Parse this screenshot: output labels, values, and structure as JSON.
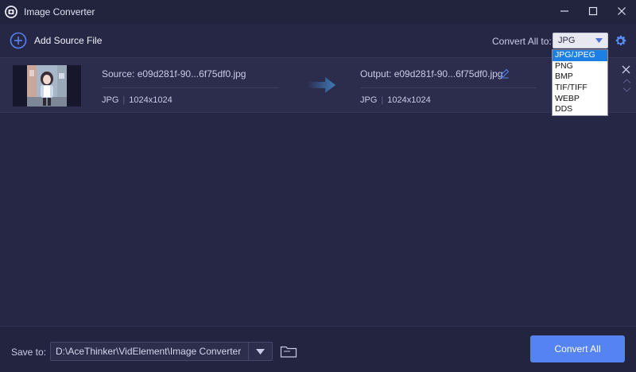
{
  "window": {
    "title": "Image Converter",
    "icons": {
      "logo": "converter-logo-icon",
      "minimize": "minimize-icon",
      "maximize": "maximize-icon",
      "close": "close-icon"
    }
  },
  "toolbar": {
    "add_source_label": "Add Source File",
    "add_icon": "plus-circle-icon",
    "convert_all_label": "Convert All to:",
    "format_value": "JPG",
    "settings_icon": "gear-icon"
  },
  "format_dropdown": {
    "options": [
      "JPG/JPEG",
      "PNG",
      "BMP",
      "TIF/TIFF",
      "WEBP",
      "DDS"
    ],
    "selected": "JPG/JPEG"
  },
  "file": {
    "source_label": "Source: e09d281f-90...6f75df0.jpg",
    "source_format": "JPG",
    "source_size": "1024x1024",
    "output_label": "Output: e09d281f-90...6f75df0.jpg",
    "output_format": "JPG",
    "output_size": "1024x1024"
  },
  "footer": {
    "save_to_label": "Save to:",
    "save_path": "D:\\AceThinker\\VidElement\\Image Converter",
    "convert_button": "Convert All"
  },
  "colors": {
    "accent": "#5583f4",
    "background": "#262745",
    "titlebar": "#22233d",
    "row": "#2c2d4c",
    "selection": "#1c7fe3"
  }
}
